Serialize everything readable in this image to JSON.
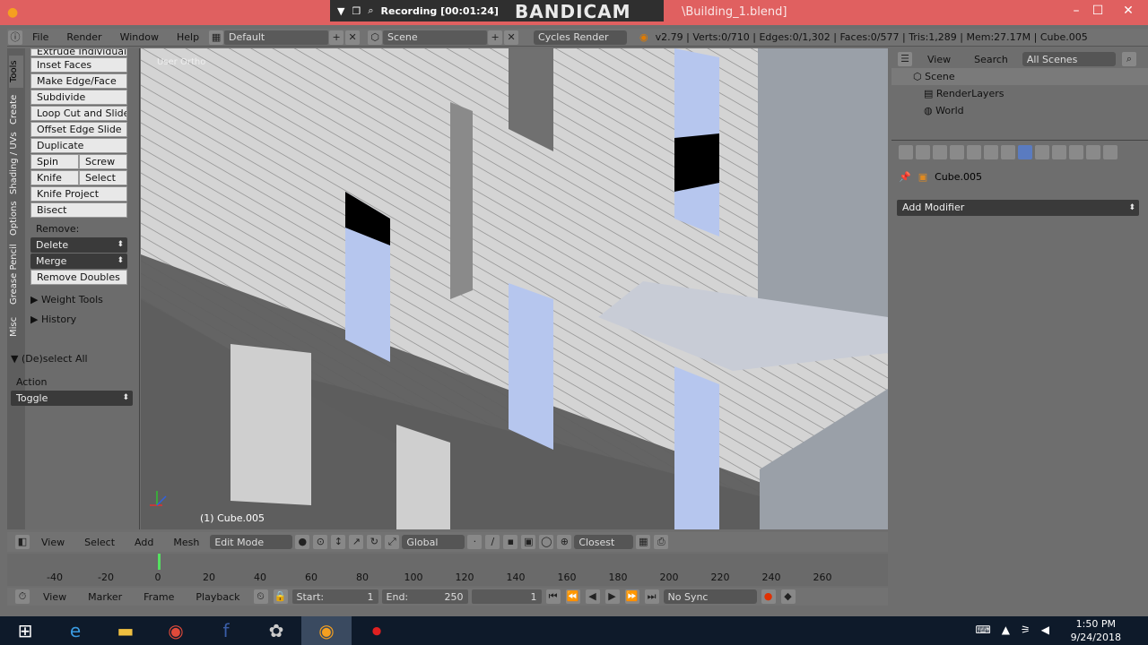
{
  "window": {
    "title": "\\Building_1.blend]",
    "min": "–",
    "max": "☐",
    "close": "✕"
  },
  "recorder": {
    "status": "Recording [00:01:24]",
    "brand": "BANDICAM"
  },
  "infobar": {
    "menus": [
      "File",
      "Render",
      "Window",
      "Help"
    ],
    "layout": "Default",
    "scene": "Scene",
    "engine": "Cycles Render",
    "stats": "v2.79 | Verts:0/710 | Edges:0/1,302 | Faces:0/577 | Tris:1,289 | Mem:27.17M | Cube.005"
  },
  "tabs": [
    "Tools",
    "Create",
    "Shading / UVs",
    "Options",
    "Grease Pencil",
    "Misc"
  ],
  "tools": {
    "buttons": [
      "Extrude Individual",
      "Inset Faces",
      "Make Edge/Face",
      "Subdivide",
      "Loop Cut and Slide",
      "Offset Edge Slide",
      "Duplicate"
    ],
    "spin": "Spin",
    "screw": "Screw",
    "knife": "Knife",
    "select": "Select",
    "knife_project": "Knife Project",
    "bisect": "Bisect",
    "remove_label": "Remove:",
    "delete": "Delete",
    "merge": "Merge",
    "remove_doubles": "Remove Doubles",
    "weight_tools": "Weight Tools",
    "history": "History"
  },
  "operator": {
    "title": "(De)select All",
    "action_label": "Action",
    "action_value": "Toggle"
  },
  "viewport": {
    "view_label": "User Ortho",
    "object_label": "(1) Cube.005"
  },
  "vpbar": {
    "menus": [
      "View",
      "Select",
      "Add",
      "Mesh"
    ],
    "mode": "Edit Mode",
    "orientation": "Global",
    "snap": "Closest"
  },
  "timeline": {
    "ticks": [
      "-40",
      "-20",
      "0",
      "20",
      "40",
      "60",
      "80",
      "100",
      "120",
      "140",
      "160",
      "180",
      "200",
      "220",
      "240",
      "260"
    ],
    "menus": [
      "View",
      "Marker",
      "Frame",
      "Playback"
    ],
    "start_label": "Start:",
    "start": "1",
    "end_label": "End:",
    "end": "250",
    "current": "1",
    "sync": "No Sync"
  },
  "outliner": {
    "menus": [
      "View",
      "Search"
    ],
    "filter": "All Scenes",
    "items": [
      "Scene",
      "RenderLayers",
      "World"
    ]
  },
  "properties": {
    "object": "Cube.005",
    "add_modifier": "Add Modifier"
  },
  "taskbar": {
    "time": "1:50 PM",
    "date": "9/24/2018"
  }
}
